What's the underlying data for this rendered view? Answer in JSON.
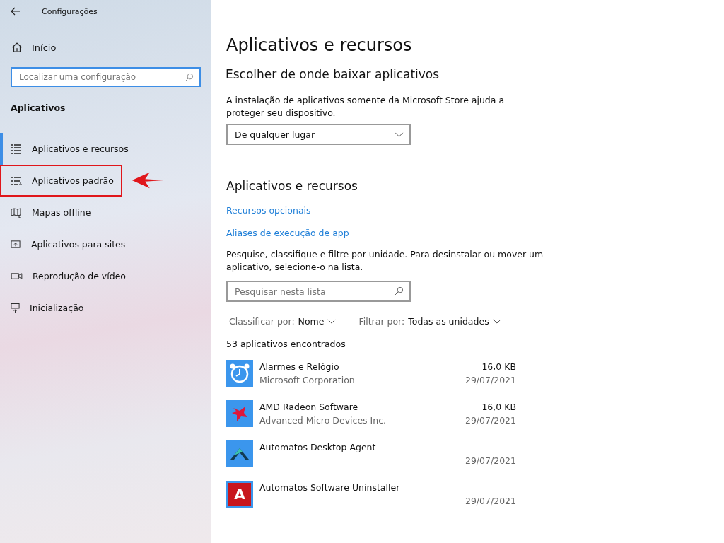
{
  "window": {
    "title": "Configurações"
  },
  "sidebar": {
    "home": "Início",
    "search": {
      "placeholder": "Localizar uma configuração"
    },
    "section": "Aplicativos",
    "items": [
      {
        "label": "Aplicativos e recursos",
        "kind": "list",
        "selected": true,
        "highlighted": false
      },
      {
        "label": "Aplicativos padrão",
        "kind": "default",
        "selected": false,
        "highlighted": true
      },
      {
        "label": "Mapas offline",
        "kind": "map",
        "selected": false,
        "highlighted": false
      },
      {
        "label": "Aplicativos para sites",
        "kind": "web",
        "selected": false,
        "highlighted": false
      },
      {
        "label": "Reprodução de vídeo",
        "kind": "video",
        "selected": false,
        "highlighted": false
      },
      {
        "label": "Inicialização",
        "kind": "startup",
        "selected": false,
        "highlighted": false
      }
    ]
  },
  "main": {
    "title": "Aplicativos e recursos",
    "install": {
      "heading": "Escolher de onde baixar aplicativos",
      "description": "A instalação de aplicativos somente da Microsoft Store ajuda a proteger seu dispositivo.",
      "dropdown": "De qualquer lugar"
    },
    "features": {
      "heading": "Aplicativos e recursos",
      "links": [
        "Recursos opcionais",
        "Aliases de execução de app"
      ],
      "description": "Pesquise, classifique e filtre por unidade. Para desinstalar ou mover um aplicativo, selecione-o na lista.",
      "search": {
        "placeholder": "Pesquisar nesta lista"
      },
      "sort": {
        "label": "Classificar por:",
        "value": "Nome"
      },
      "filter": {
        "label": "Filtrar por:",
        "value": "Todas as unidades"
      },
      "count": "53 aplicativos encontrados",
      "apps": [
        {
          "name": "Alarmes e Relógio",
          "publisher": "Microsoft Corporation",
          "size": "16,0 KB",
          "date": "29/07/2021",
          "kind": "alarm"
        },
        {
          "name": "AMD Radeon Software",
          "publisher": "Advanced Micro Devices Inc.",
          "size": "16,0 KB",
          "date": "29/07/2021",
          "kind": "amd"
        },
        {
          "name": "Automatos Desktop Agent",
          "date": "29/07/2021",
          "kind": "agent"
        },
        {
          "name": "Automatos Software Uninstaller",
          "date": "29/07/2021",
          "kind": "letter",
          "icon_label": "A"
        }
      ]
    }
  }
}
